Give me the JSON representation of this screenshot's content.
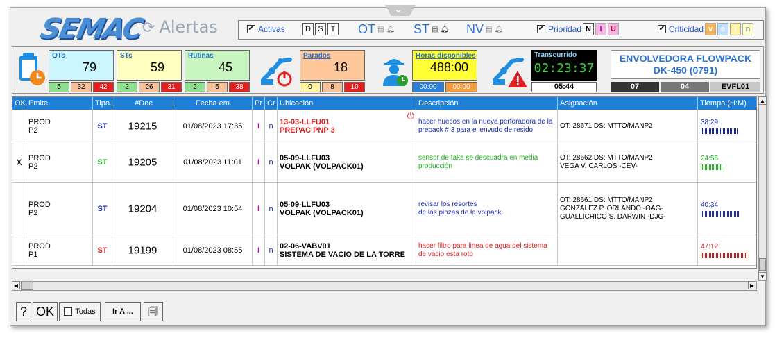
{
  "app": {
    "logo_text": "SEMAC",
    "title": "Alertas",
    "refresh_glyph": "⟳"
  },
  "filters": {
    "activas_label": "Activas",
    "activas_checked": true,
    "dst_buttons": [
      "D",
      "S",
      "T"
    ],
    "ot_label": "OT",
    "st_label": "ST",
    "nv_label": "NV",
    "prioridad_label": "Prioridad",
    "prioridad_checked": true,
    "prioridad_buttons": [
      "N",
      "I",
      "U"
    ],
    "criticidad_label": "Criticidad",
    "criticidad_checked": true,
    "criticidad_buttons": [
      "v",
      "e",
      "i",
      "n"
    ]
  },
  "stats": {
    "ots": {
      "label": "OTs",
      "value": "79",
      "subs": [
        "5",
        "32",
        "42"
      ]
    },
    "sts": {
      "label": "STs",
      "value": "59",
      "subs": [
        "2",
        "26",
        "31"
      ]
    },
    "rutinas": {
      "label": "Rutinas",
      "value": "45",
      "subs": [
        "2",
        "5",
        "38"
      ]
    },
    "parados": {
      "label": "Parados",
      "value": "18",
      "subs": [
        "0",
        "8",
        "10"
      ]
    },
    "horas": {
      "label": "Horas disponibles",
      "value": "488:00",
      "subs": [
        "00:00",
        "00:00"
      ]
    },
    "transcurrido": {
      "label": "Transcurrido",
      "value": "02:23:37",
      "sub": "05:44"
    },
    "pills": [
      "07",
      "04",
      "EVFL01"
    ],
    "machine_line1": "ENVOLVEDORA FLOWPACK",
    "machine_line2": "DK-450 (0791)"
  },
  "grid": {
    "headers": [
      "OK",
      "Emite",
      "Tipo",
      "#Doc",
      "Fecha em.",
      "Pr",
      "Cr",
      "Ubicación",
      "Descripción",
      "Asignación",
      "Tiempo (H:M)"
    ],
    "rows": [
      {
        "ok": "",
        "emite1": "PROD",
        "emite2": "P2",
        "tipo": "ST",
        "doc": "19215",
        "fecha": "01/08/2023 17:35",
        "pr": "I",
        "cr": "n",
        "ubic1": "13-03-LLFU01",
        "ubic2": "PREPAC PNP 3",
        "desc": "hacer huecos en la nueva perforadora de la prepack # 3 para el envudo de resido",
        "asig": "OT: 28671     DS: MTTO/MANP2",
        "tiempo": "38:29",
        "bar_fraction": 0.75
      },
      {
        "ok": "X",
        "emite1": "PROD",
        "emite2": "P2",
        "tipo": "ST",
        "doc": "19205",
        "fecha": "01/08/2023 11:01",
        "pr": "I",
        "cr": "n",
        "ubic1": "05-09-LLFU03",
        "ubic2": "VOLPAK (VOLPACK01)",
        "desc": "sensor de taka se descuadra en media producción",
        "asig": "OT: 28662     DS: MTTO/MANP2\nVEGA V. CARLOS     -CEV-",
        "tiempo": "24:56",
        "bar_fraction": 0.45
      },
      {
        "ok": "",
        "emite1": "PROD",
        "emite2": "P2",
        "tipo": "ST",
        "doc": "19204",
        "fecha": "01/08/2023 10:54",
        "pr": "I",
        "cr": "n",
        "ubic1": "05-09-LLFU03",
        "ubic2": "VOLPAK (VOLPACK01)",
        "desc": "revisar los resortes\nde las pinzas de la volpack",
        "asig": "OT: 28661     DS: MTTO/MANP2\nGONZALEZ P. ORLANDO     -OAG-\nGUALLICHICO S. DARWIN     -DJG-",
        "tiempo": "40:34",
        "bar_fraction": 0.8
      },
      {
        "ok": "",
        "emite1": "PROD",
        "emite2": "P1",
        "tipo": "ST",
        "doc": "19199",
        "fecha": "01/08/2023 08:55",
        "pr": "I",
        "cr": "n",
        "ubic1": "02-06-VABV01",
        "ubic2": "SISTEMA DE VACIO DE LA TORRE",
        "desc": "hacer filtro para linea de agua del sistema de vacio esta roto",
        "asig": "",
        "tiempo": "47:12",
        "bar_fraction": 0.95
      }
    ]
  },
  "bottom": {
    "help": "?",
    "ok": "OK",
    "todas": "Todas",
    "ir_a": "Ir A ..."
  },
  "colors": {
    "header_blue": "#1e80d8",
    "ots_bg": "#ccf6ff",
    "sts_bg": "#ffffc0",
    "rutinas_bg": "#c8f5c0",
    "parados_bg": "#ffc89a",
    "horas_bg": "#ffff33"
  }
}
